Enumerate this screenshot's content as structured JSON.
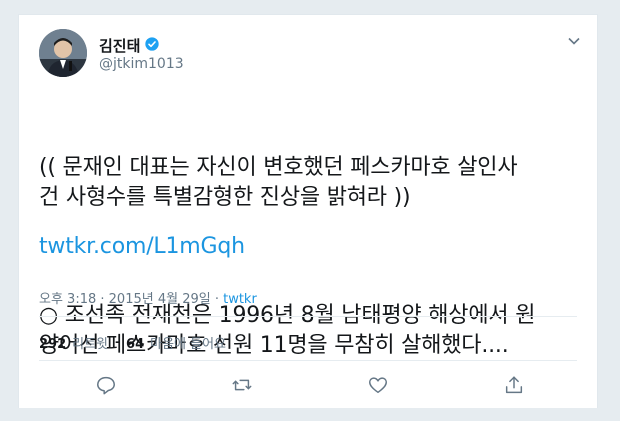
{
  "author": {
    "name": "김진태",
    "handle": "@jtkim1013"
  },
  "tweet": {
    "line1": "(( 문재인 대표는 자신이 변호했던 페스카마호 살인사\n건 사형수를 특별감형한 진상을 밝혀라 ))",
    "line2": "○ 조선족 전재천은 1996년 8월 남태평양 해상에서 원\n양어선 페스카마호 선원 11명을 무참히 살해했다....",
    "link": "twtkr.com/L1mGqh"
  },
  "meta": {
    "time": "오후 3:18",
    "sep1": " · ",
    "date": "2015년 4월 29일",
    "sep2": " · ",
    "source": "twtkr"
  },
  "stats": {
    "retweets": "292",
    "retweets_label": "리트윗",
    "likes": "64",
    "likes_label": "마음에 들어요"
  },
  "colors": {
    "link": "#1b95e0",
    "muted": "#657786",
    "border": "#e1e8ed"
  },
  "icons": [
    "verified-badge-icon",
    "chevron-down-icon",
    "reply-icon",
    "retweet-icon",
    "like-icon",
    "share-icon"
  ]
}
